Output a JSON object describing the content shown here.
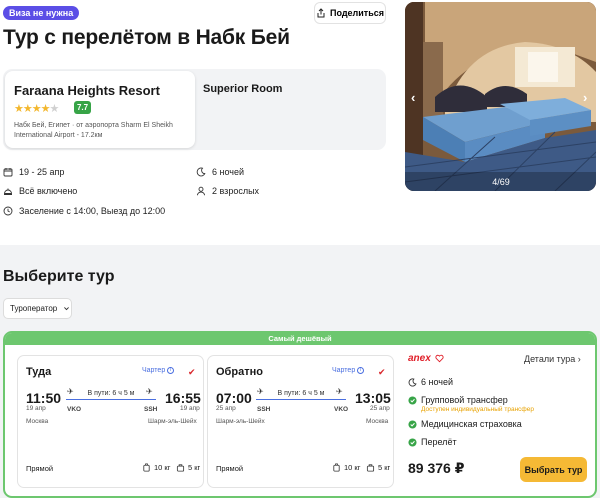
{
  "header": {
    "visa_badge": "Виза не нужна",
    "share_label": "Поделиться",
    "title": "Тур с перелётом в Набк Бей"
  },
  "hotel": {
    "name": "Faraana Heights Resort",
    "stars_filled": 4,
    "stars_total": 5,
    "rating": "7.7",
    "location": "Набк Бей, Египет  · от аэропорта Sharm El Sheikh International Airport - 17.2км",
    "room": "Superior Room"
  },
  "trip_info": {
    "dates": "19 - 25 апр",
    "nights": "6 ночей",
    "meals": "Всё включено",
    "guests": "2 взрослых",
    "checkin": "Заселение с 14:00, Выезд до 12:00"
  },
  "gallery": {
    "counter": "4/69",
    "prev_icon": "‹",
    "next_icon": "›"
  },
  "tours": {
    "section_title": "Выберите тур",
    "operator_filter": "Туроператор",
    "cheapest_label": "Самый дешёвый",
    "card": {
      "outbound": {
        "title": "Туда",
        "charter": "Чартер",
        "dep_time": "11:50",
        "dep_date": "19 апр",
        "dep_code": "VKO",
        "dep_city": "Москва",
        "duration": "В пути: 6 ч 5 м",
        "arr_time": "16:55",
        "arr_date": "19 апр",
        "arr_code": "SSH",
        "arr_city": "Шарм-эль-Шейх",
        "direct": "Прямой",
        "bag_checked": "10 кг",
        "bag_cabin": "5 кг"
      },
      "inbound": {
        "title": "Обратно",
        "charter": "Чартер",
        "dep_time": "07:00",
        "dep_date": "25 апр",
        "dep_code": "SSH",
        "dep_city": "Шарм-эль-Шейх",
        "duration": "В пути: 6 ч 5 м",
        "arr_time": "13:05",
        "arr_date": "25 апр",
        "arr_code": "VKO",
        "arr_city": "Москва",
        "direct": "Прямой",
        "bag_checked": "10 кг",
        "bag_cabin": "5 кг"
      },
      "operator": "anex",
      "details_label": "Детали тура",
      "nights": "6 ночей",
      "features": [
        "Групповой трансфер",
        "Медицинская страховка",
        "Перелёт"
      ],
      "transfer_note": "Доступен индивидуальный трансфер",
      "price": "89 376 ₽",
      "choose_label": "Выбрать тур"
    }
  },
  "colors": {
    "accent_purple": "#5b4ee6",
    "rating_green": "#37a447",
    "cheapest_green": "#6dc76f",
    "button_yellow": "#f5b935",
    "link_blue": "#4a6fe0"
  }
}
